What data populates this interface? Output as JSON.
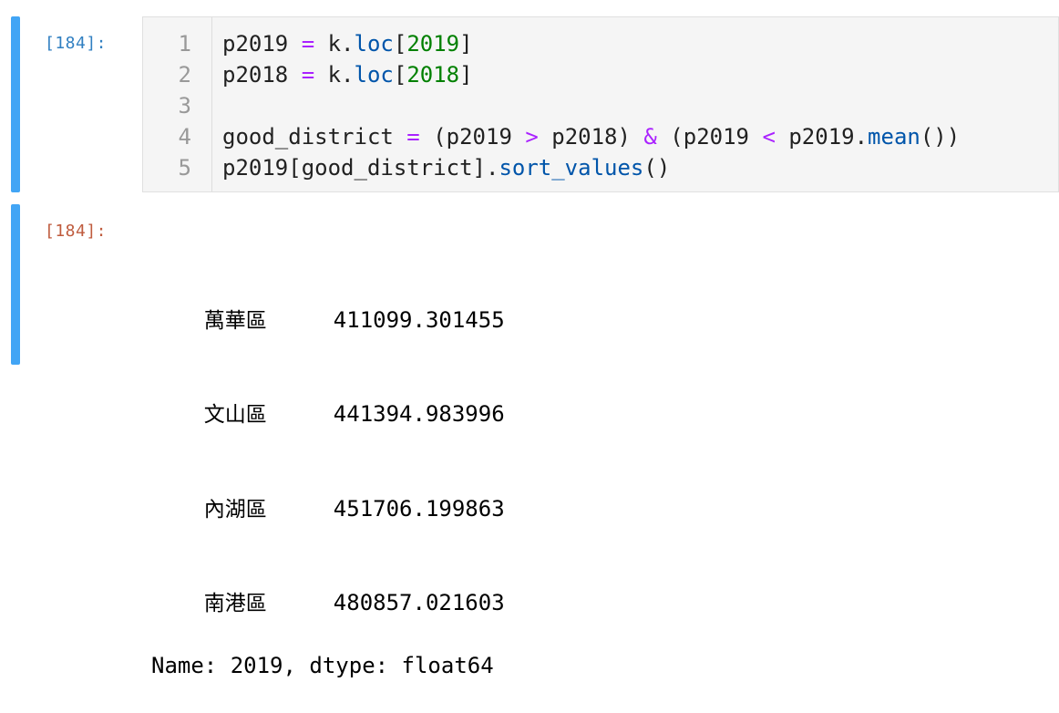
{
  "input_cell": {
    "prompt": "[184]:",
    "line_numbers": [
      "1",
      "2",
      "3",
      "4",
      "5"
    ],
    "code_lines": [
      [
        {
          "t": "p2019 "
        },
        {
          "t": "=",
          "c": "op"
        },
        {
          "t": " k."
        },
        {
          "t": "loc",
          "c": "fn"
        },
        {
          "t": "["
        },
        {
          "t": "2019",
          "c": "num"
        },
        {
          "t": "]"
        }
      ],
      [
        {
          "t": "p2018 "
        },
        {
          "t": "=",
          "c": "op"
        },
        {
          "t": " k."
        },
        {
          "t": "loc",
          "c": "fn"
        },
        {
          "t": "["
        },
        {
          "t": "2018",
          "c": "num"
        },
        {
          "t": "]"
        }
      ],
      [],
      [
        {
          "t": "good_district "
        },
        {
          "t": "=",
          "c": "op"
        },
        {
          "t": " (p2019 "
        },
        {
          "t": ">",
          "c": "op"
        },
        {
          "t": " p2018) "
        },
        {
          "t": "&",
          "c": "op"
        },
        {
          "t": " (p2019 "
        },
        {
          "t": "<",
          "c": "op"
        },
        {
          "t": " p2019."
        },
        {
          "t": "mean",
          "c": "fn"
        },
        {
          "t": "())"
        }
      ],
      [
        {
          "t": "p2019[good_district]."
        },
        {
          "t": "sort_values",
          "c": "fn"
        },
        {
          "t": "()"
        }
      ]
    ],
    "colors": {
      "operator": "#aa22ff",
      "number": "#008000",
      "function": "#0055aa"
    }
  },
  "output_cell": {
    "prompt": "[184]:",
    "rows": [
      {
        "district": "萬華區",
        "value": "411099.301455"
      },
      {
        "district": "文山區",
        "value": "441394.983996"
      },
      {
        "district": "內湖區",
        "value": "451706.199863"
      },
      {
        "district": "南港區",
        "value": "480857.021603"
      }
    ],
    "footer": "Name: 2019, dtype: float64"
  }
}
